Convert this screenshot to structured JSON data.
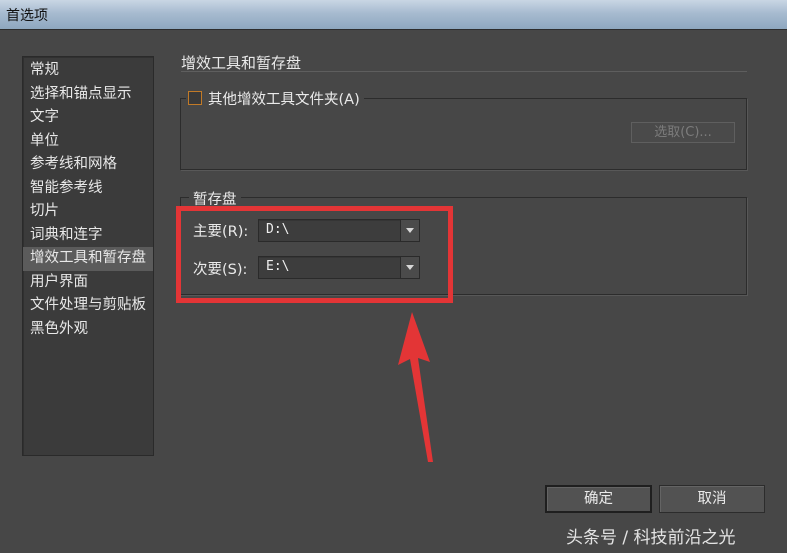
{
  "window": {
    "title": "首选项"
  },
  "sidebar": {
    "items": [
      {
        "label": "常规"
      },
      {
        "label": "选择和锚点显示"
      },
      {
        "label": "文字"
      },
      {
        "label": "单位"
      },
      {
        "label": "参考线和网格"
      },
      {
        "label": "智能参考线"
      },
      {
        "label": "切片"
      },
      {
        "label": "词典和连字"
      },
      {
        "label": "增效工具和暂存盘",
        "selected": true
      },
      {
        "label": "用户界面"
      },
      {
        "label": "文件处理与剪贴板"
      },
      {
        "label": "黑色外观"
      }
    ]
  },
  "main": {
    "section_title": "增效工具和暂存盘",
    "plugins_group": {
      "checkbox_label": "其他增效工具文件夹(A)",
      "checked": false,
      "choose_button": "选取(C)..."
    },
    "scratch_group": {
      "legend": "暂存盘",
      "primary": {
        "label": "主要(R):",
        "value": "D:\\"
      },
      "secondary": {
        "label": "次要(S):",
        "value": "E:\\"
      }
    }
  },
  "footer": {
    "ok_button": "确定",
    "cancel_button": "取消"
  },
  "annotation": {
    "highlight_color": "#e33536"
  },
  "watermark": "头条号 / 科技前沿之光"
}
